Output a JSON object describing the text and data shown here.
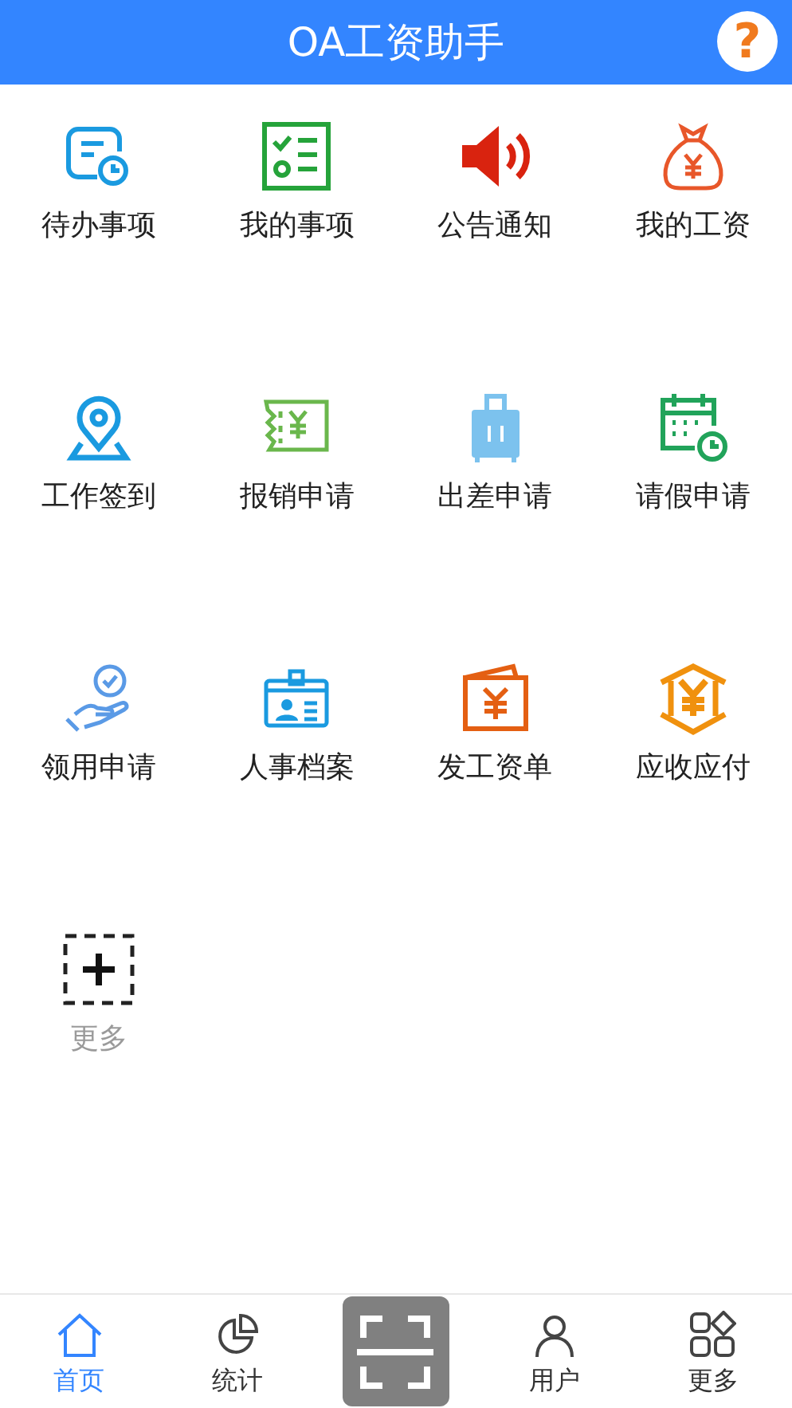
{
  "header": {
    "title": "OA工资助手",
    "help": "?"
  },
  "items": [
    {
      "kind": "todo",
      "label": "待办事项"
    },
    {
      "kind": "checklist",
      "label": "我的事项"
    },
    {
      "kind": "speaker",
      "label": "公告通知"
    },
    {
      "kind": "moneybag",
      "label": "我的工资"
    },
    {
      "kind": "location",
      "label": "工作签到"
    },
    {
      "kind": "receipt",
      "label": "报销申请"
    },
    {
      "kind": "suitcase",
      "label": "出差申请"
    },
    {
      "kind": "calendar",
      "label": "请假申请"
    },
    {
      "kind": "hand",
      "label": "领用申请"
    },
    {
      "kind": "idcard",
      "label": "人事档案"
    },
    {
      "kind": "wallet",
      "label": "发工资单"
    },
    {
      "kind": "house",
      "label": "应收应付"
    },
    {
      "kind": "add",
      "label": "更多"
    }
  ],
  "tabs": [
    {
      "kind": "home",
      "label": "首页",
      "selected": true
    },
    {
      "kind": "stats",
      "label": "统计",
      "selected": false
    },
    {
      "kind": "scan"
    },
    {
      "kind": "user",
      "label": "用户",
      "selected": false
    },
    {
      "kind": "more",
      "label": "更多",
      "selected": false
    }
  ]
}
